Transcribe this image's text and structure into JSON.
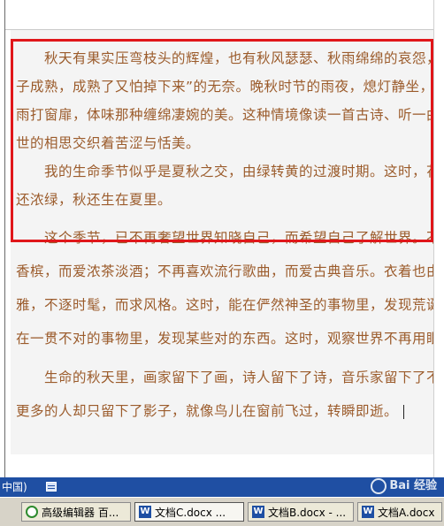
{
  "document": {
    "paragraphs": [
      {
        "lines": [
          "秋天有果实压弯枝头的辉煌，也有秋风瑟瑟、秋雨绵绵的哀怨，果",
          "子成熟，成熟了又怕掉下来”的无奈。晚秋时节的雨夜，熄灯静坐，听",
          "雨打窗扉，体味那种缠绵凄婉的美。这种情境像读一首古诗、听一曲",
          "世的相思交织着苦涩与恬美。"
        ]
      },
      {
        "lines": [
          "我的生命季节似乎是夏秋之交，由绿转黄的过渡时期。这时，花",
          "还浓绿，秋还生在夏里。"
        ]
      },
      {
        "lines": [
          "这个季节，已不再奢望世界知晓自己，而希望自己了解世界。不再",
          "香槟，而爱浓茶淡酒；不再喜欢流行歌曲，而爱古典音乐。衣着也由",
          "雅，不逐时髦，而求风格。这时，能在俨然神圣的事物里，发现荒诞",
          "在一贯不对的事物里，发现某些对的东西。这时，观察世界不再用眼，"
        ]
      },
      {
        "lines": [
          "生命的秋天里，画家留下了画，诗人留下了诗，音乐家留下了不",
          "更多的人却只留下了影子，就像鸟儿在窗前飞过，转瞬即逝。"
        ]
      }
    ]
  },
  "status_bar": {
    "language": "中国)",
    "watermark": "Bai 经验"
  },
  "taskbar": {
    "items": [
      {
        "label": "高级编辑器 百...",
        "icon": "ie-icon",
        "active": false
      },
      {
        "label": "文档C.docx ...",
        "icon": "word-icon",
        "active": true
      },
      {
        "label": "文档B.docx - ...",
        "icon": "word-icon",
        "active": false
      },
      {
        "label": "文档A.docx",
        "icon": "word-icon",
        "active": false
      }
    ]
  },
  "colors": {
    "text": "#9b5b2b",
    "highlight": "#e0161a",
    "status_bar": "#1f4fa3"
  }
}
